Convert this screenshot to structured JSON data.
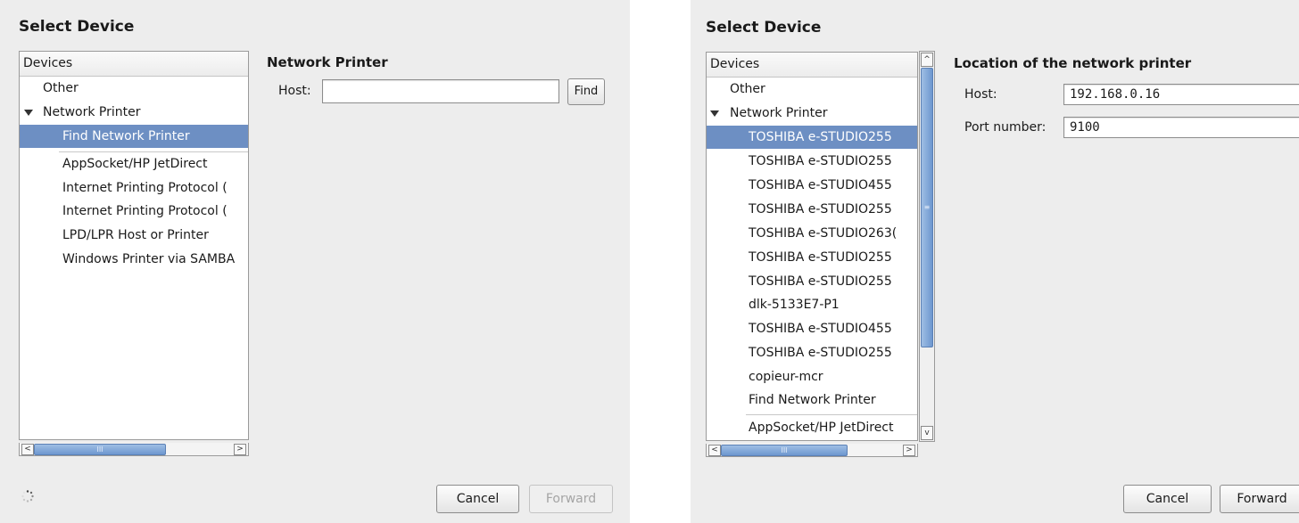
{
  "left": {
    "title": "Select Device",
    "devices_header": "Devices",
    "tree": [
      {
        "label": "Other"
      },
      {
        "label": "Network Printer"
      },
      {
        "label": "Find Network Printer"
      },
      {
        "label": "AppSocket/HP JetDirect"
      },
      {
        "label": "Internet Printing Protocol ("
      },
      {
        "label": "Internet Printing Protocol ("
      },
      {
        "label": "LPD/LPR Host or Printer"
      },
      {
        "label": "Windows Printer via SAMBA"
      }
    ],
    "selected_row": "Find Network Printer",
    "section_title": "Network Printer",
    "host_label": "Host:",
    "host_value": "",
    "find_button": "Find",
    "cancel_button": "Cancel",
    "forward_button": "Forward",
    "scroll_glyph": "III",
    "left_arrow": "<",
    "right_arrow": ">"
  },
  "right": {
    "title": "Select Device",
    "devices_header": "Devices",
    "tree": [
      {
        "label": "Other"
      },
      {
        "label": "Network Printer"
      },
      {
        "label": "TOSHIBA e-STUDIO255"
      },
      {
        "label": "TOSHIBA e-STUDIO255"
      },
      {
        "label": "TOSHIBA e-STUDIO455"
      },
      {
        "label": "TOSHIBA e-STUDIO255"
      },
      {
        "label": "TOSHIBA e-STUDIO263("
      },
      {
        "label": "TOSHIBA e-STUDIO255"
      },
      {
        "label": "TOSHIBA e-STUDIO255"
      },
      {
        "label": "dlk-5133E7-P1"
      },
      {
        "label": "TOSHIBA e-STUDIO455"
      },
      {
        "label": "TOSHIBA e-STUDIO255"
      },
      {
        "label": "copieur-mcr"
      },
      {
        "label": "Find Network Printer"
      },
      {
        "label": "AppSocket/HP JetDirect"
      }
    ],
    "section_title": "Location of the network printer",
    "host_label": "Host:",
    "host_value": "192.168.0.16",
    "port_label": "Port number:",
    "port_value": "9100",
    "cancel_button": "Cancel",
    "forward_button": "Forward",
    "scroll_glyph": "III",
    "vscroll_glyph": "≡",
    "left_arrow": "<",
    "right_arrow": ">",
    "up_arrow": "^",
    "down_arrow": "v"
  },
  "colors": {
    "selection": "#6d8fc3",
    "panel_bg": "#ededed"
  },
  "icons": {
    "expander": "expander-open-icon",
    "spinner": "busy-spinner-icon"
  }
}
